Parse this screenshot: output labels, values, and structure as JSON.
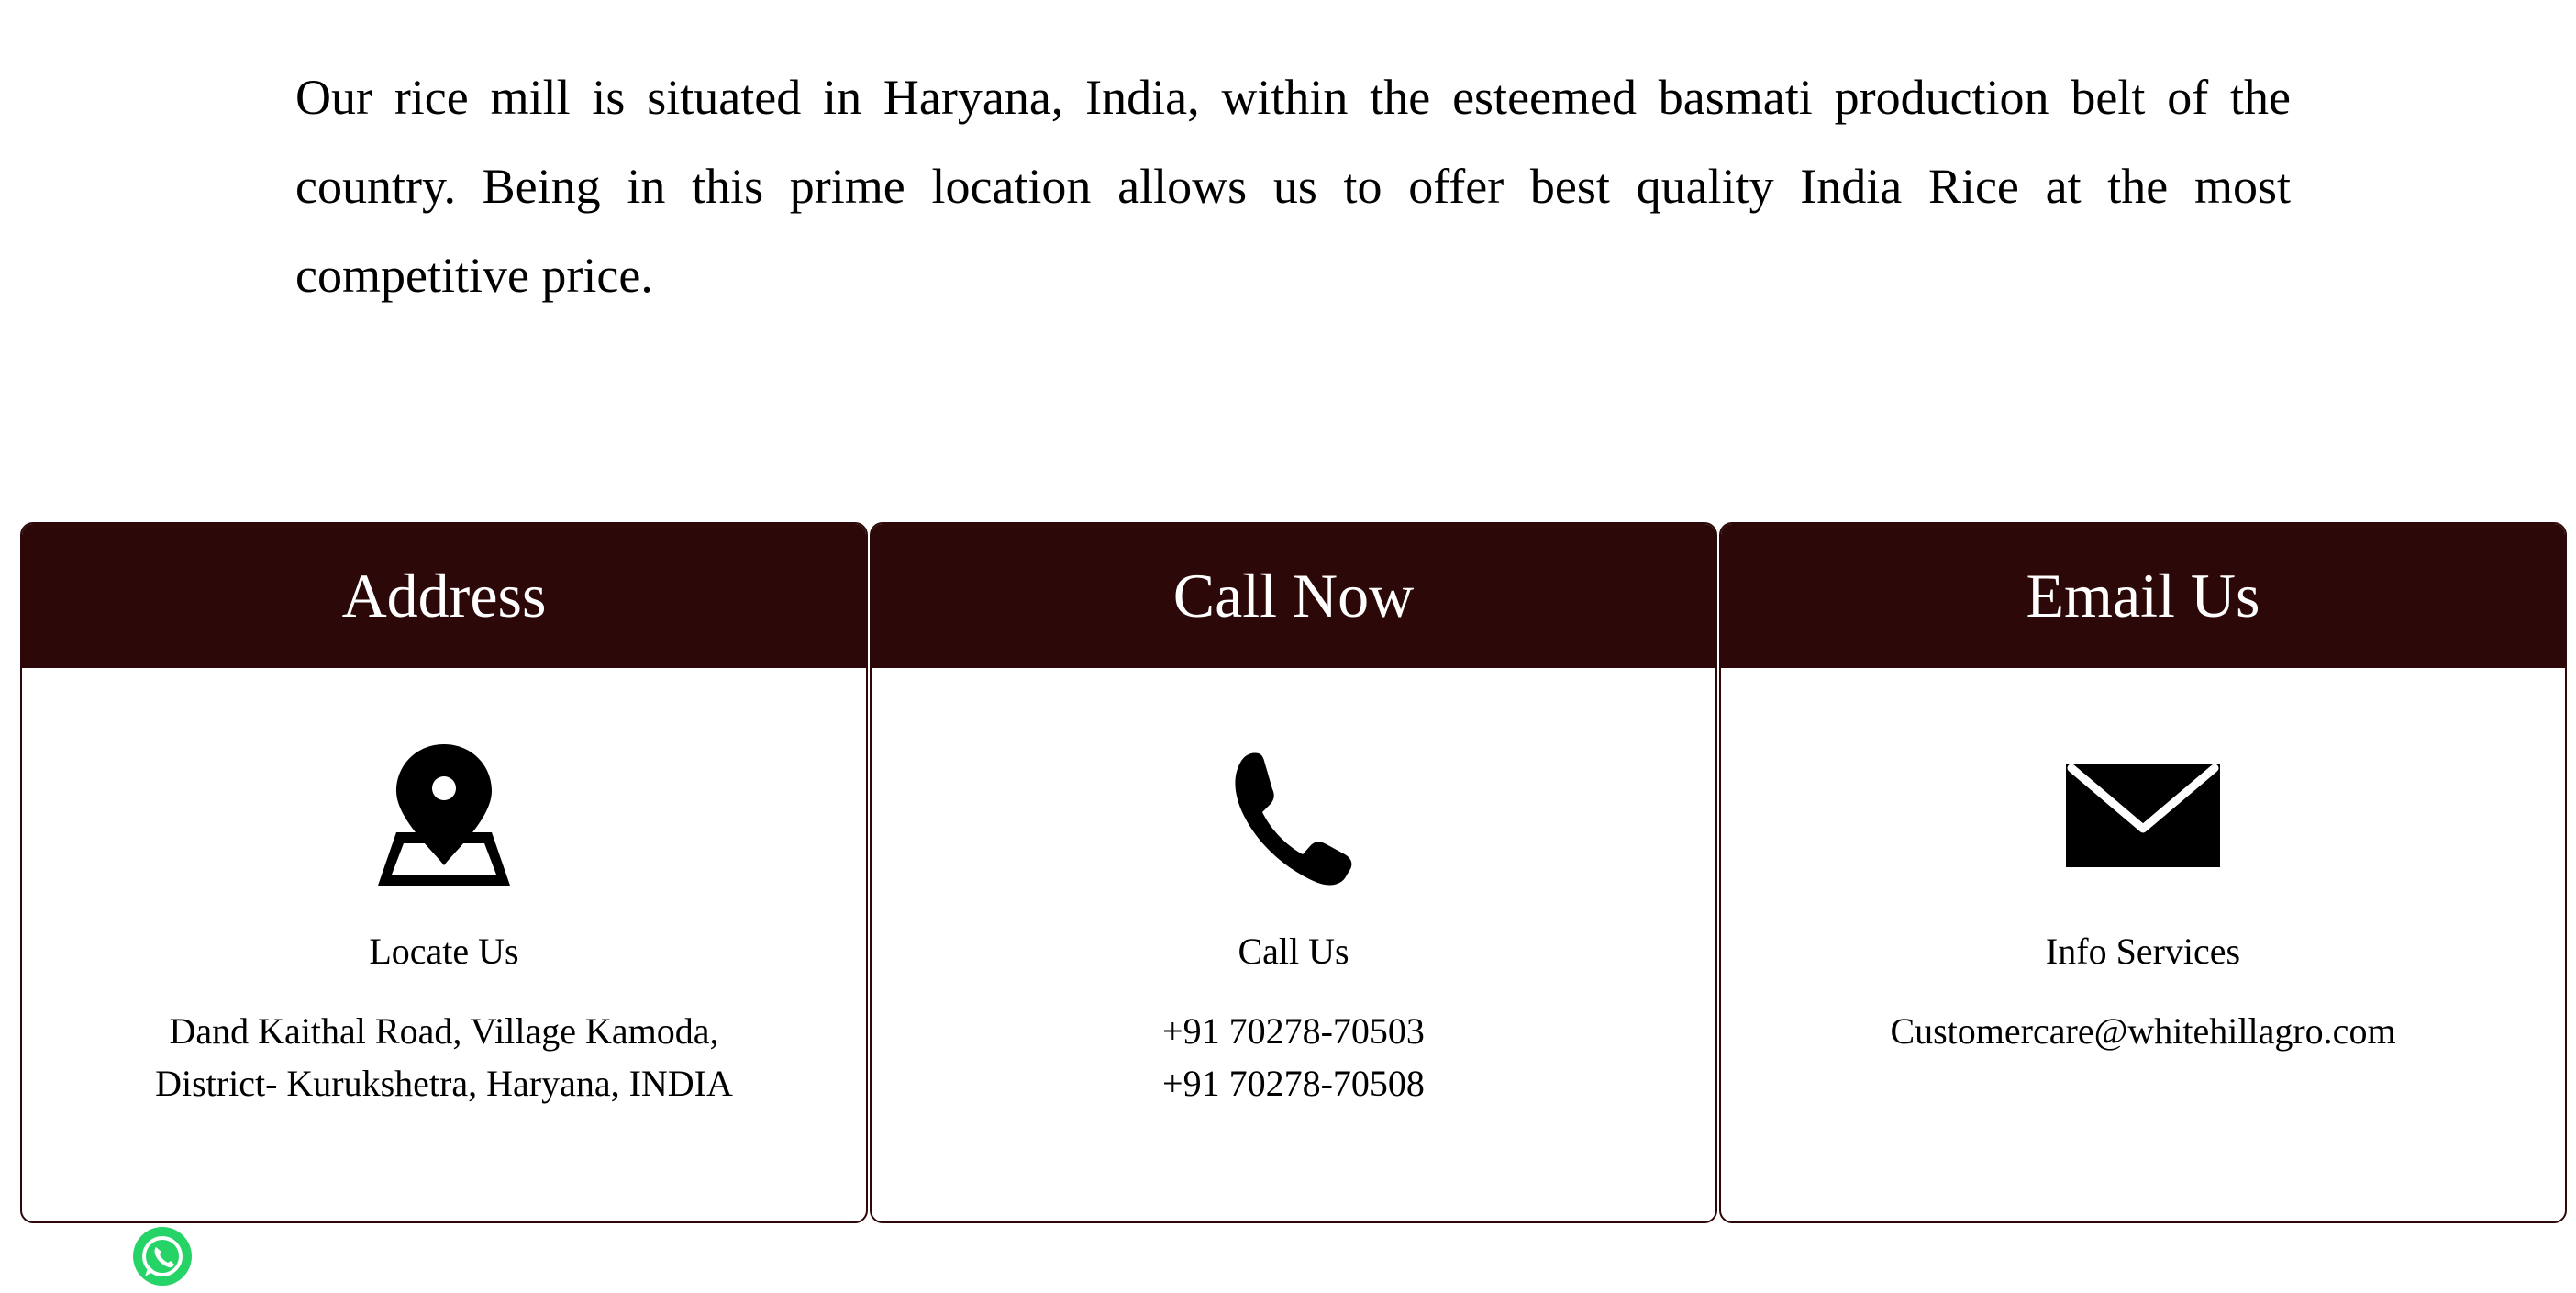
{
  "intro": {
    "text": "Our rice mill is situated in Haryana, India, within the esteemed basmati production belt of the country. Being in this prime location allows us to offer best quality India Rice at the most competitive price."
  },
  "cards": {
    "address": {
      "title": "Address",
      "icon": "map-pin-icon",
      "label": "Locate Us",
      "lines": [
        "Dand Kaithal Road, Village Kamoda,",
        "District- Kurukshetra, Haryana, INDIA"
      ]
    },
    "call": {
      "title": "Call Now",
      "icon": "phone-icon",
      "label": "Call Us",
      "lines": [
        "+91 70278-70503",
        "+91 70278-70508"
      ]
    },
    "email": {
      "title": "Email Us",
      "icon": "envelope-icon",
      "label": "Info Services",
      "lines": [
        "Customercare@whitehillagro.com"
      ]
    }
  },
  "floating": {
    "whatsapp_icon": "whatsapp-icon"
  },
  "colors": {
    "header_bg": "#2d0808",
    "header_text": "#ffffff",
    "whatsapp_green": "#25d366"
  }
}
